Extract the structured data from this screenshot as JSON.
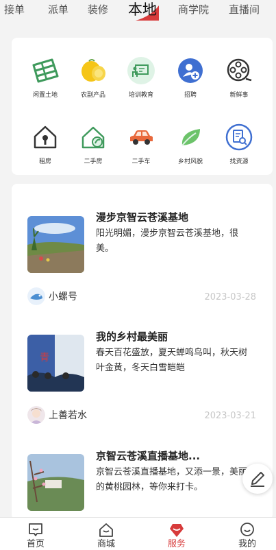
{
  "top_tabs": {
    "items": [
      "接单",
      "派单",
      "装修",
      "本地",
      "商学院",
      "直播间"
    ],
    "active": "本地"
  },
  "services": [
    {
      "label": "闲置土地",
      "icon": "farmland-icon"
    },
    {
      "label": "农副产品",
      "icon": "lemon-icon"
    },
    {
      "label": "培训教育",
      "icon": "presentation-board-icon"
    },
    {
      "label": "招聘",
      "icon": "add-person-icon"
    },
    {
      "label": "新鲜事",
      "icon": "film-reel-icon"
    },
    {
      "label": "租房",
      "icon": "house-key-icon"
    },
    {
      "label": "二手房",
      "icon": "house-leaf-icon"
    },
    {
      "label": "二手车",
      "icon": "car-icon"
    },
    {
      "label": "乡村风貌",
      "icon": "leaf-icon"
    },
    {
      "label": "找资源",
      "icon": "document-search-icon"
    }
  ],
  "feed": [
    {
      "title": "漫步京智云苍溪基地",
      "desc": "阳光明媚，漫步京智云苍溪基地，很美。",
      "author": "小螺号",
      "date": "2023-03-28"
    },
    {
      "title": "我的乡村最美丽",
      "desc": "春天百花盛放，夏天蝉鸣鸟叫，秋天树叶金黄，冬天白雪皑皑",
      "author": "上善若水",
      "date": "2023-03-21"
    },
    {
      "title": "京智云苍溪直播基地...",
      "desc": "京智云苍溪直播基地，又添一景，美丽的黄桃园林，等你来打卡。",
      "author": "",
      "date": ""
    }
  ],
  "bottom_nav": {
    "items": [
      "首页",
      "商城",
      "服务",
      "我的"
    ],
    "active": "服务"
  },
  "colors": {
    "accent_red": "#d73b3b",
    "green": "#3f9a5c",
    "blue": "#3f6fd1",
    "orange": "#e8683c"
  }
}
